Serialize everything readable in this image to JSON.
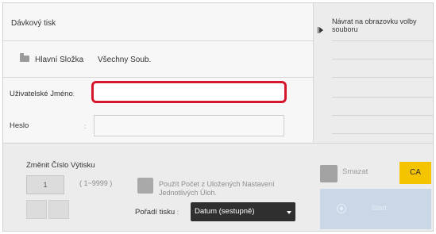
{
  "header": {
    "title": "Dávkový tisk"
  },
  "location": {
    "folder_label": "Hlavní Složka",
    "filter_label": "Všechny Soub."
  },
  "form": {
    "user_label": "Uživatelské Jméno",
    "user_value": "",
    "colon": ":",
    "password_label": "Heslo",
    "password_value": ""
  },
  "copies": {
    "title": "Změnit Číslo Výtisku",
    "value": "1",
    "range": "( 1~9999 )",
    "use_saved_label": "Použít Počet z Uložených Nastavení Jednotlivých Úloh."
  },
  "order": {
    "label": "Pořadí tisku",
    "selected": "Datum (sestupně)"
  },
  "sidebar": {
    "back_label": "Návrat na obrazovku volby souboru"
  },
  "actions": {
    "delete_label": "Smazat",
    "ca_label": "CA",
    "start_label": "Start"
  },
  "colors": {
    "focus_border": "#d6162c",
    "ca_button": "#f5c400",
    "start_button": "#c9d7e6",
    "select_background": "#2f2f2f"
  },
  "icons": {
    "folder": "folder-icon",
    "back": "back-arrow-icon",
    "start": "start-icon",
    "dropdown": "chevron-down-icon"
  }
}
